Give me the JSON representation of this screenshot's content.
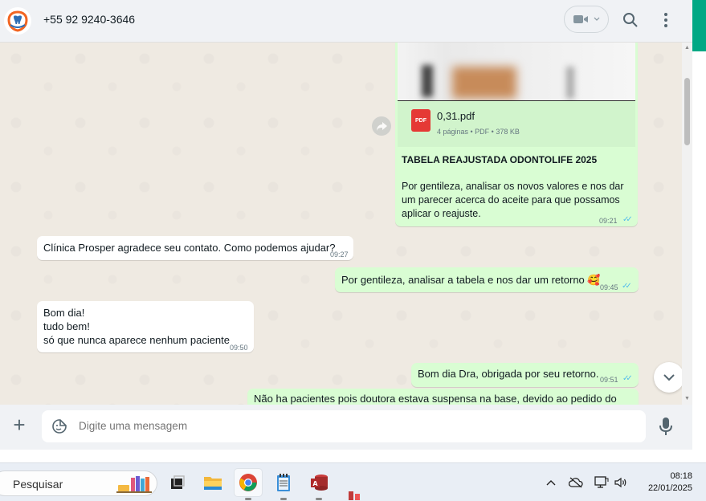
{
  "header": {
    "contact_name": "+55 92 9240-3646"
  },
  "document": {
    "file_name": "0,31.pdf",
    "file_meta": "4 páginas • PDF • 378 KB",
    "pdf_badge": "PDF",
    "title": "TABELA REAJUSTADA ODONTOLIFE 2025",
    "caption": "Por gentileza, analisar os novos valores e nos dar um parecer acerca do aceite para que possamos aplicar o reajuste.",
    "time": "09:21"
  },
  "messages": [
    {
      "dir": "in",
      "text": "Clínica Prosper agradece seu contato. Como podemos ajudar?",
      "time": "09:27"
    },
    {
      "dir": "out",
      "text": "Por gentileza, analisar a tabela e nos dar um retorno 🥰",
      "time": "09:45"
    },
    {
      "dir": "in",
      "lines": [
        "Bom dia!",
        "tudo bem!",
        "só que nunca aparece nenhum paciente"
      ],
      "time": "09:50"
    },
    {
      "dir": "out",
      "text": "Bom dia Dra, obrigada por seu retorno.",
      "time": "09:51"
    },
    {
      "dir": "out",
      "text": "Não ha pacientes pois doutora estava suspensa na base, devido ao pedido do"
    }
  ],
  "composer": {
    "placeholder": "Digite uma mensagem"
  },
  "taskbar": {
    "search_label": "Pesquisar",
    "time": "08:18",
    "date": "22/01/2025"
  },
  "colors": {
    "outgoing_bubble": "#d9fdd3",
    "incoming_bubble": "#ffffff",
    "read_ticks": "#53bdeb",
    "accent": "#00a884"
  }
}
